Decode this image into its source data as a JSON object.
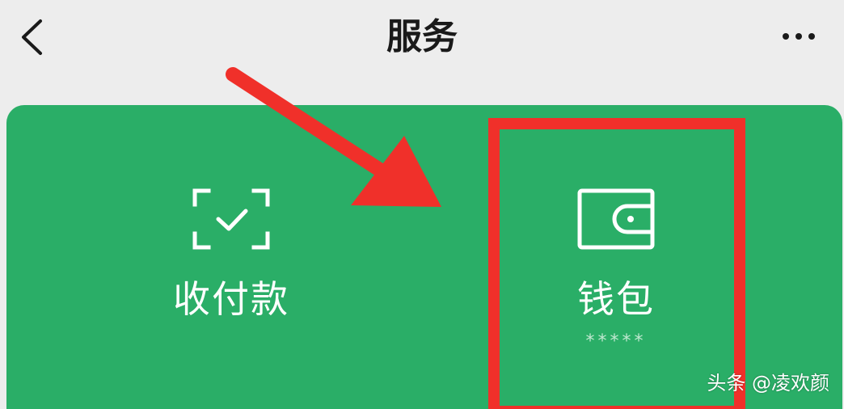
{
  "header": {
    "title": "服务",
    "back_icon": "chevron-left-icon",
    "more_icon": "more-dots-icon"
  },
  "services": [
    {
      "label": "收付款",
      "icon": "scan-check-icon",
      "sub": ""
    },
    {
      "label": "钱包",
      "icon": "wallet-icon",
      "sub": "*****"
    }
  ],
  "annotation": {
    "arrow_color": "#f0302a",
    "box_color": "#f0302a"
  },
  "watermark": "头条 @凌欢颜",
  "colors": {
    "card_green": "#2aae67",
    "background": "#ededed",
    "text_dark": "#1a1a1a"
  }
}
